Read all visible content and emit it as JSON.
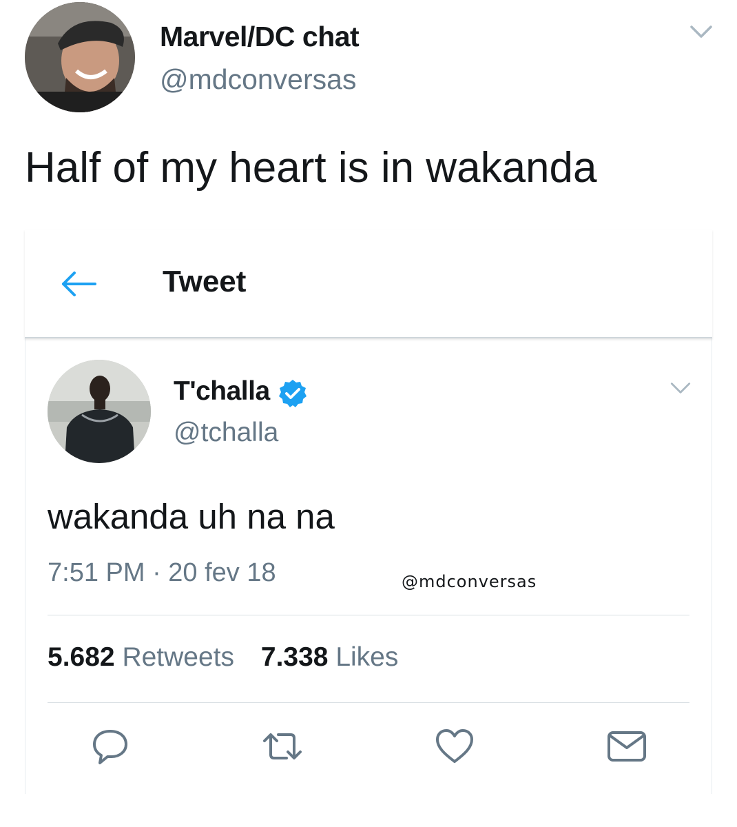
{
  "outer_tweet": {
    "display_name": "Marvel/DC chat",
    "handle": "@mdconversas",
    "text": "Half of my heart is in wakanda"
  },
  "screenshot": {
    "header": {
      "title": "Tweet"
    },
    "tweet": {
      "display_name": "T'challa",
      "verified": true,
      "handle": "@tchalla",
      "text": "wakanda uh na na",
      "timestamp": "7:51 PM · 20 fev 18",
      "watermark": "@mdconversas",
      "retweets_count": "5.682",
      "retweets_label": "Retweets",
      "likes_count": "7.338",
      "likes_label": "Likes"
    },
    "actions": [
      "reply-icon",
      "retweet-icon",
      "like-icon",
      "message-icon"
    ]
  },
  "colors": {
    "primary_text": "#14171a",
    "secondary_text": "#657786",
    "accent_blue": "#1da1f2",
    "divider": "#e6ecf0"
  }
}
